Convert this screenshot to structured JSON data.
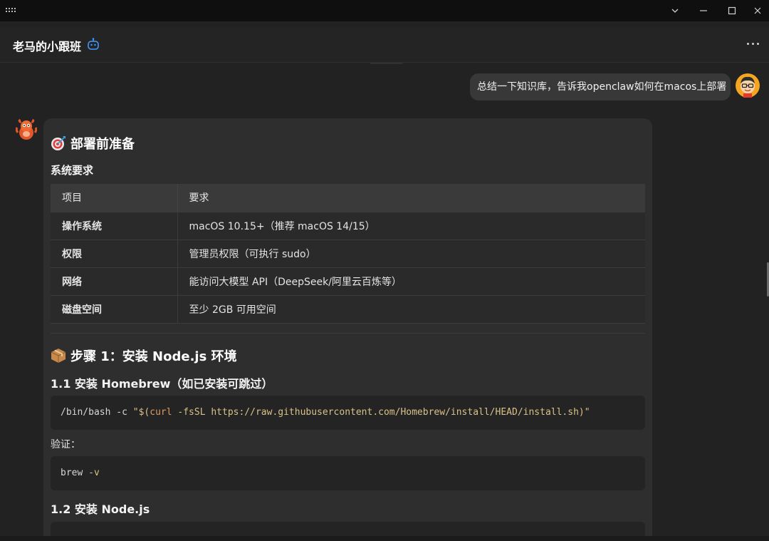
{
  "window": {
    "icons": [
      "grip-icon",
      "chevron-down-icon",
      "minimize-icon",
      "maximize-icon",
      "close-icon"
    ]
  },
  "header": {
    "title": "老马的小跟班",
    "badge_icon": "robot-icon",
    "menu_icon": "more-icon"
  },
  "user_message": {
    "text": "总结一下知识库，告诉我openclaw如何在macos上部署"
  },
  "assistant": {
    "section1_title": "部署前准备",
    "section1_icon": "target-icon",
    "sysreq_title": "系统要求",
    "table": {
      "headers": [
        "项目",
        "要求"
      ],
      "rows": [
        [
          "操作系统",
          "macOS 10.15+（推荐 macOS 14/15）"
        ],
        [
          "权限",
          "管理员权限（可执行 sudo）"
        ],
        [
          "网络",
          "能访问大模型 API（DeepSeek/阿里云百炼等）"
        ],
        [
          "磁盘空间",
          "至少 2GB 可用空间"
        ]
      ]
    },
    "section2_title": "步骤 1：安装 Node.js 环境",
    "section2_icon": "package-icon",
    "sub1_title": "1.1 安装 Homebrew（如已安装可跳过）",
    "code1": {
      "cmd": "/bin/bash",
      "flag": " -c ",
      "str_open": "\"$(",
      "kw": "curl",
      "rest": " -fsSL https://raw.githubusercontent.com/Homebrew/install/HEAD/install.sh)\""
    },
    "verify_label": "验证：",
    "code2": {
      "cmd": "brew",
      "flag": " -v"
    },
    "sub2_title": "1.2 安装 Node.js"
  }
}
